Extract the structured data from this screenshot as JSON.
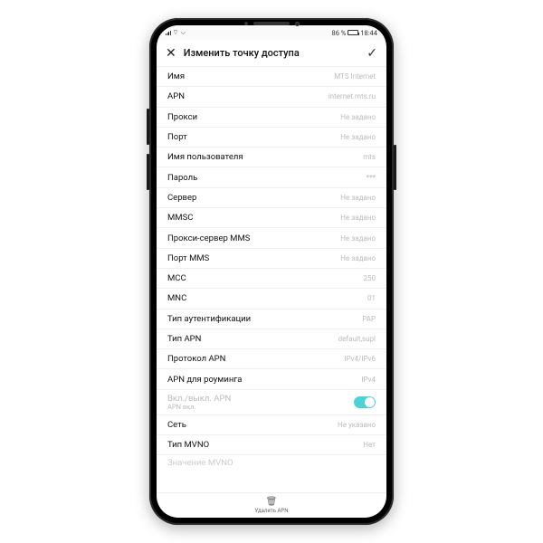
{
  "statusbar": {
    "battery_text": "86 %",
    "time": "18:44"
  },
  "header": {
    "title": "Изменить точку доступа"
  },
  "rows": [
    {
      "label": "Имя",
      "value": "MTS Internet"
    },
    {
      "label": "APN",
      "value": "internet.mts.ru"
    },
    {
      "label": "Прокси",
      "value": "Не задано"
    },
    {
      "label": "Порт",
      "value": "Не задано"
    },
    {
      "label": "Имя пользователя",
      "value": "mts"
    },
    {
      "label": "Пароль",
      "value": "***"
    },
    {
      "label": "Сервер",
      "value": "Не задано"
    },
    {
      "label": "MMSC",
      "value": "Не задано"
    },
    {
      "label": "Прокси-сервер MMS",
      "value": "Не задано"
    },
    {
      "label": "Порт MMS",
      "value": "Не задано"
    },
    {
      "label": "MCC",
      "value": "250"
    },
    {
      "label": "MNC",
      "value": "01"
    },
    {
      "label": "Тип аутентификации",
      "value": "PAP"
    },
    {
      "label": "Тип APN",
      "value": "default,supl"
    },
    {
      "label": "Протокол APN",
      "value": "IPv4/IPv6"
    },
    {
      "label": "APN для роуминга",
      "value": "IPv4"
    }
  ],
  "toggle": {
    "label": "Вкл./выкл. APN",
    "sub": "APN вкл."
  },
  "rows_after": [
    {
      "label": "Сеть",
      "value": "Не указано"
    },
    {
      "label": "Тип MVNO",
      "value": "Нет"
    }
  ],
  "row_dim": {
    "label": "Значение MVNO",
    "value": ""
  },
  "bottom": {
    "label": "Удалить APN"
  }
}
